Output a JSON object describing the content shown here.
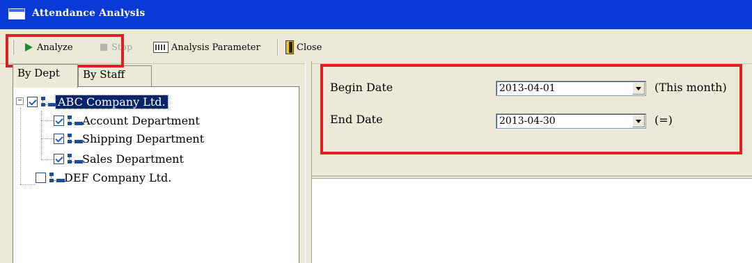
{
  "window": {
    "title": "Attendance Analysis"
  },
  "toolbar": {
    "analyze_label": "Analyze",
    "stop_label": "Stop",
    "parameter_label": "Analysis Parameter",
    "close_label": "Close"
  },
  "tabs": {
    "dept": "By Dept",
    "staff": "By Staff"
  },
  "tree": {
    "items": [
      {
        "label": "ABC Company Ltd.",
        "checked": true
      },
      {
        "label": "Account Department",
        "checked": true
      },
      {
        "label": "Shipping Department",
        "checked": true
      },
      {
        "label": "Sales Department",
        "checked": true
      },
      {
        "label": "DEF Company Ltd.",
        "checked": false
      }
    ],
    "expander_symbol": "−"
  },
  "params": {
    "begin_label": "Begin Date",
    "begin_value": "2013-04-01",
    "begin_note": "(This month)",
    "end_label": "End Date",
    "end_value": "2013-04-30",
    "end_note": "(=)"
  },
  "colors": {
    "titlebar": "#0a3ad6",
    "highlight": "#e02020",
    "selection": "#0a246a"
  }
}
